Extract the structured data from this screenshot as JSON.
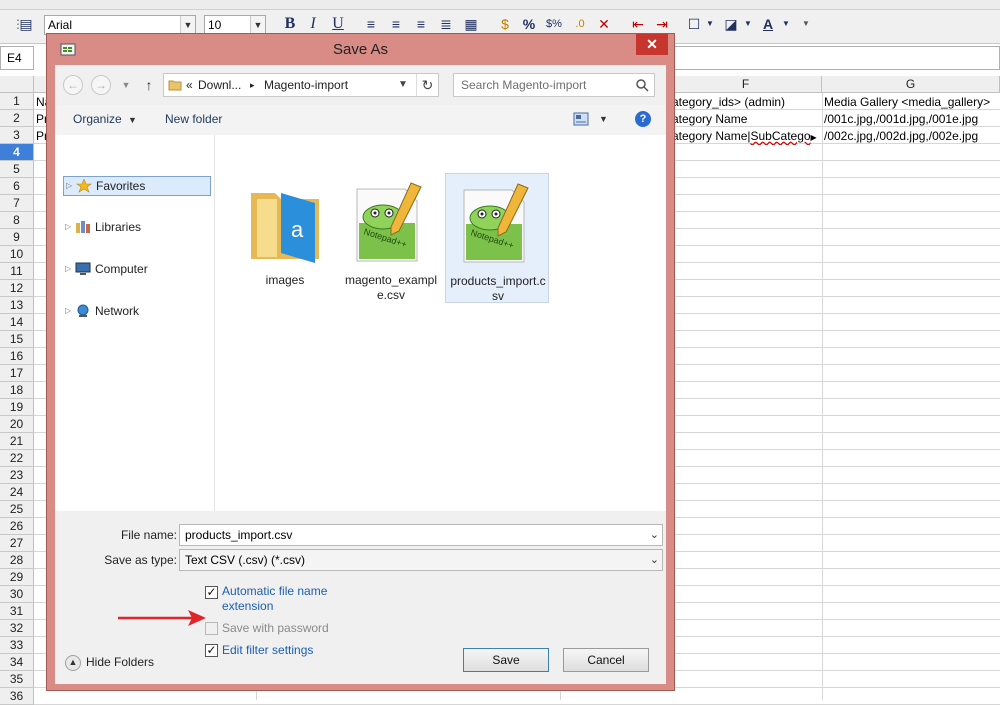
{
  "spreadsheet": {
    "font_name": "Arial",
    "font_size": "10",
    "name_box": "E4",
    "columns": [
      {
        "label": "F"
      },
      {
        "label": "G"
      }
    ],
    "rows": [
      "1",
      "2",
      "3",
      "4",
      "5",
      "6",
      "7",
      "8",
      "9",
      "10",
      "11",
      "12",
      "13",
      "14",
      "15",
      "16",
      "17",
      "18",
      "19",
      "20",
      "21",
      "22",
      "23",
      "24",
      "25",
      "26",
      "27",
      "28",
      "29",
      "30",
      "31",
      "32",
      "33",
      "34",
      "35",
      "36"
    ],
    "selected_row": "4",
    "cells": {
      "a1": "Na",
      "a2": "Pr",
      "a3": "Pr",
      "f1": "ategory_ids> (admin)",
      "f2": "ategory Name",
      "f3_a": "ategory Name|",
      "f3_b": "SubCatego",
      "g1": "Media Gallery <media_gallery>",
      "g2": "/001c.jpg,/001d.jpg,/001e.jpg",
      "g3": "/002c.jpg,/002d.jpg,/002e.jpg"
    },
    "toolbar_icons": [
      "bold-icon",
      "italic-icon",
      "underline-icon",
      "align-left-icon",
      "align-center-icon",
      "align-right-icon",
      "justify-icon",
      "merge-icon",
      "currency-icon",
      "percent-icon",
      "number-format-icon",
      "add-decimal-icon",
      "delete-decimal-icon",
      "decrease-indent-icon",
      "increase-indent-icon",
      "borders-icon",
      "background-color-icon",
      "font-color-icon"
    ]
  },
  "dialog": {
    "title": "Save As",
    "close_glyph": "✕",
    "address": {
      "prefix": "«",
      "crumb1": "Downl...",
      "separator": "▸",
      "crumb2": "Magento-import"
    },
    "search_placeholder": "Search Magento-import",
    "commands": {
      "organize": "Organize",
      "new_folder": "New folder",
      "help": "?"
    },
    "nav_items": [
      {
        "label": "Favorites",
        "icon": "star-icon",
        "selected": true
      },
      {
        "label": "Libraries",
        "icon": "libraries-icon",
        "selected": false
      },
      {
        "label": "Computer",
        "icon": "computer-icon",
        "selected": false
      },
      {
        "label": "Network",
        "icon": "network-icon",
        "selected": false
      }
    ],
    "files": [
      {
        "label": "images",
        "icon": "folder-icon"
      },
      {
        "label": "magento_example.csv",
        "icon": "notepad-plus-plus-icon"
      },
      {
        "label": "products_import.csv",
        "icon": "notepad-plus-plus-icon"
      }
    ],
    "form": {
      "file_name_label": "File name:",
      "file_name_value": "products_import.csv",
      "save_type_label": "Save as type:",
      "save_type_value": "Text CSV (.csv) (*.csv)",
      "auto_ext_label": "Automatic file name extension",
      "auto_ext_checked": true,
      "password_label": "Save with password",
      "password_checked": false,
      "filter_label": "Edit filter settings",
      "filter_checked": true
    },
    "hide_folders": "Hide Folders",
    "save_button": "Save",
    "cancel_button": "Cancel"
  },
  "colors": {
    "dialog_frame": "#d98b86",
    "close_button": "#c7362e",
    "selection_blue": "#3d7fd9",
    "link_blue": "#1a5fb4",
    "annotation_red": "#e0242a"
  }
}
